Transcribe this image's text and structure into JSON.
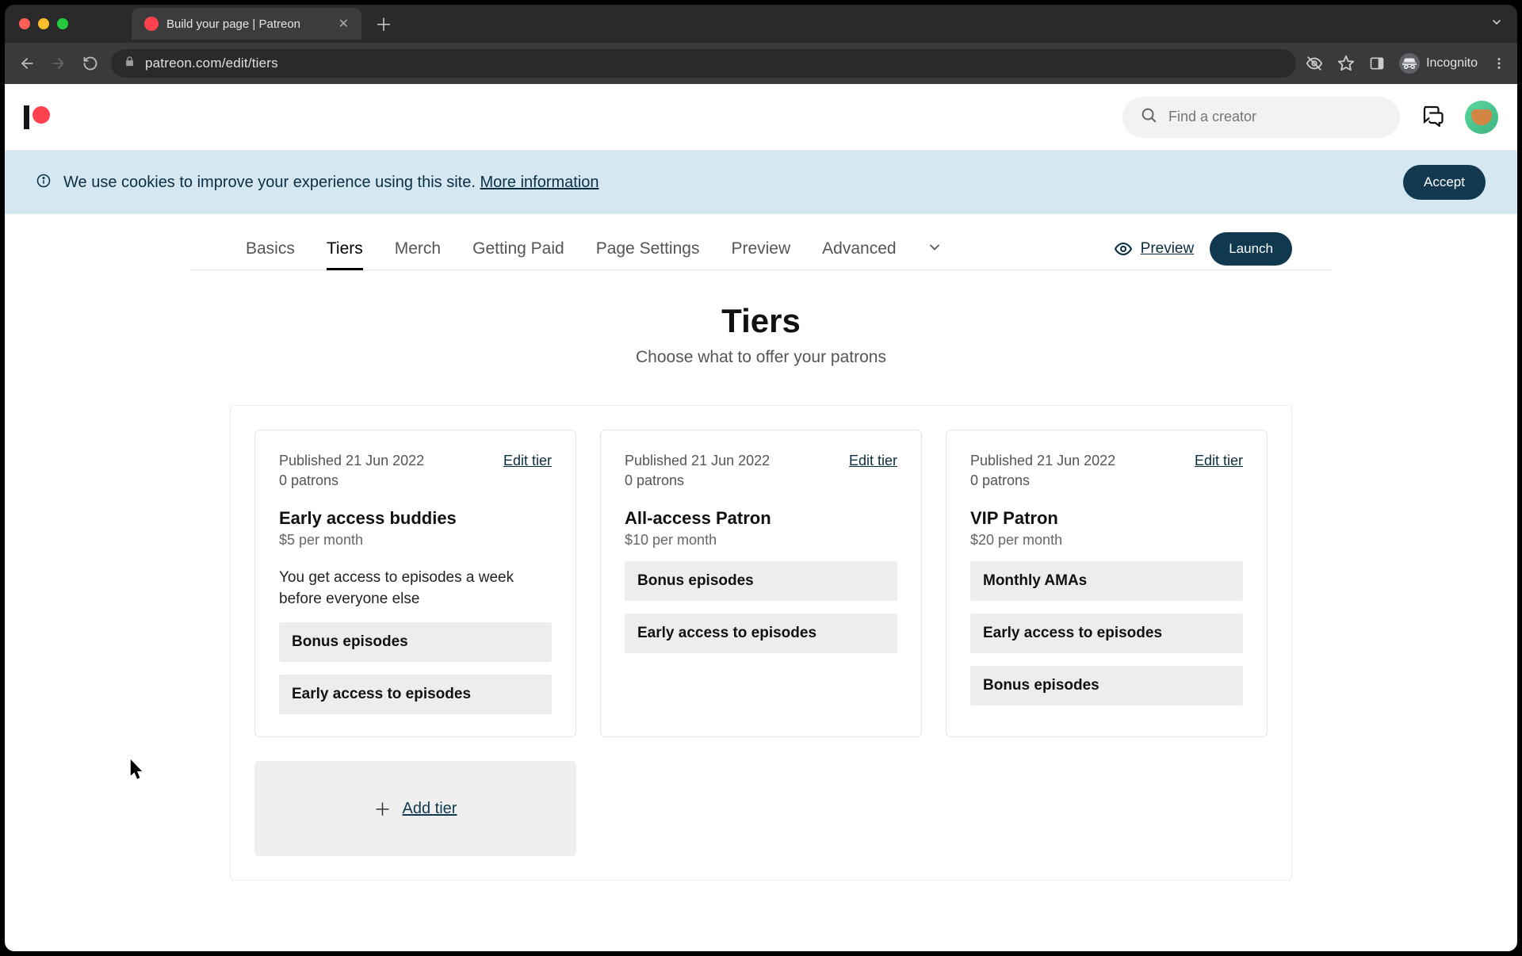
{
  "browser": {
    "tab_title": "Build your page | Patreon",
    "url": "patreon.com/edit/tiers",
    "incognito_label": "Incognito"
  },
  "header": {
    "search_placeholder": "Find a creator"
  },
  "cookie": {
    "text": "We use cookies to improve your experience using this site. ",
    "link": "More information",
    "accept": "Accept"
  },
  "nav": {
    "tabs": [
      "Basics",
      "Tiers",
      "Merch",
      "Getting Paid",
      "Page Settings",
      "Preview",
      "Advanced"
    ],
    "active_index": 1,
    "preview": "Preview",
    "launch": "Launch"
  },
  "page": {
    "title": "Tiers",
    "subtitle": "Choose what to offer your patrons"
  },
  "tiers": [
    {
      "published": "Published 21 Jun 2022",
      "patrons": "0 patrons",
      "edit": "Edit tier",
      "name": "Early access buddies",
      "price": "$5 per month",
      "description": "You get access to episodes a week before everyone else",
      "benefits": [
        "Bonus episodes",
        "Early access to episodes"
      ]
    },
    {
      "published": "Published 21 Jun 2022",
      "patrons": "0 patrons",
      "edit": "Edit tier",
      "name": "All-access Patron",
      "price": "$10 per month",
      "description": "",
      "benefits": [
        "Bonus episodes",
        "Early access to episodes"
      ]
    },
    {
      "published": "Published 21 Jun 2022",
      "patrons": "0 patrons",
      "edit": "Edit tier",
      "name": "VIP Patron",
      "price": "$20 per month",
      "description": "",
      "benefits": [
        "Monthly AMAs",
        "Early access to episodes",
        "Bonus episodes"
      ]
    }
  ],
  "add_tier": "Add tier"
}
